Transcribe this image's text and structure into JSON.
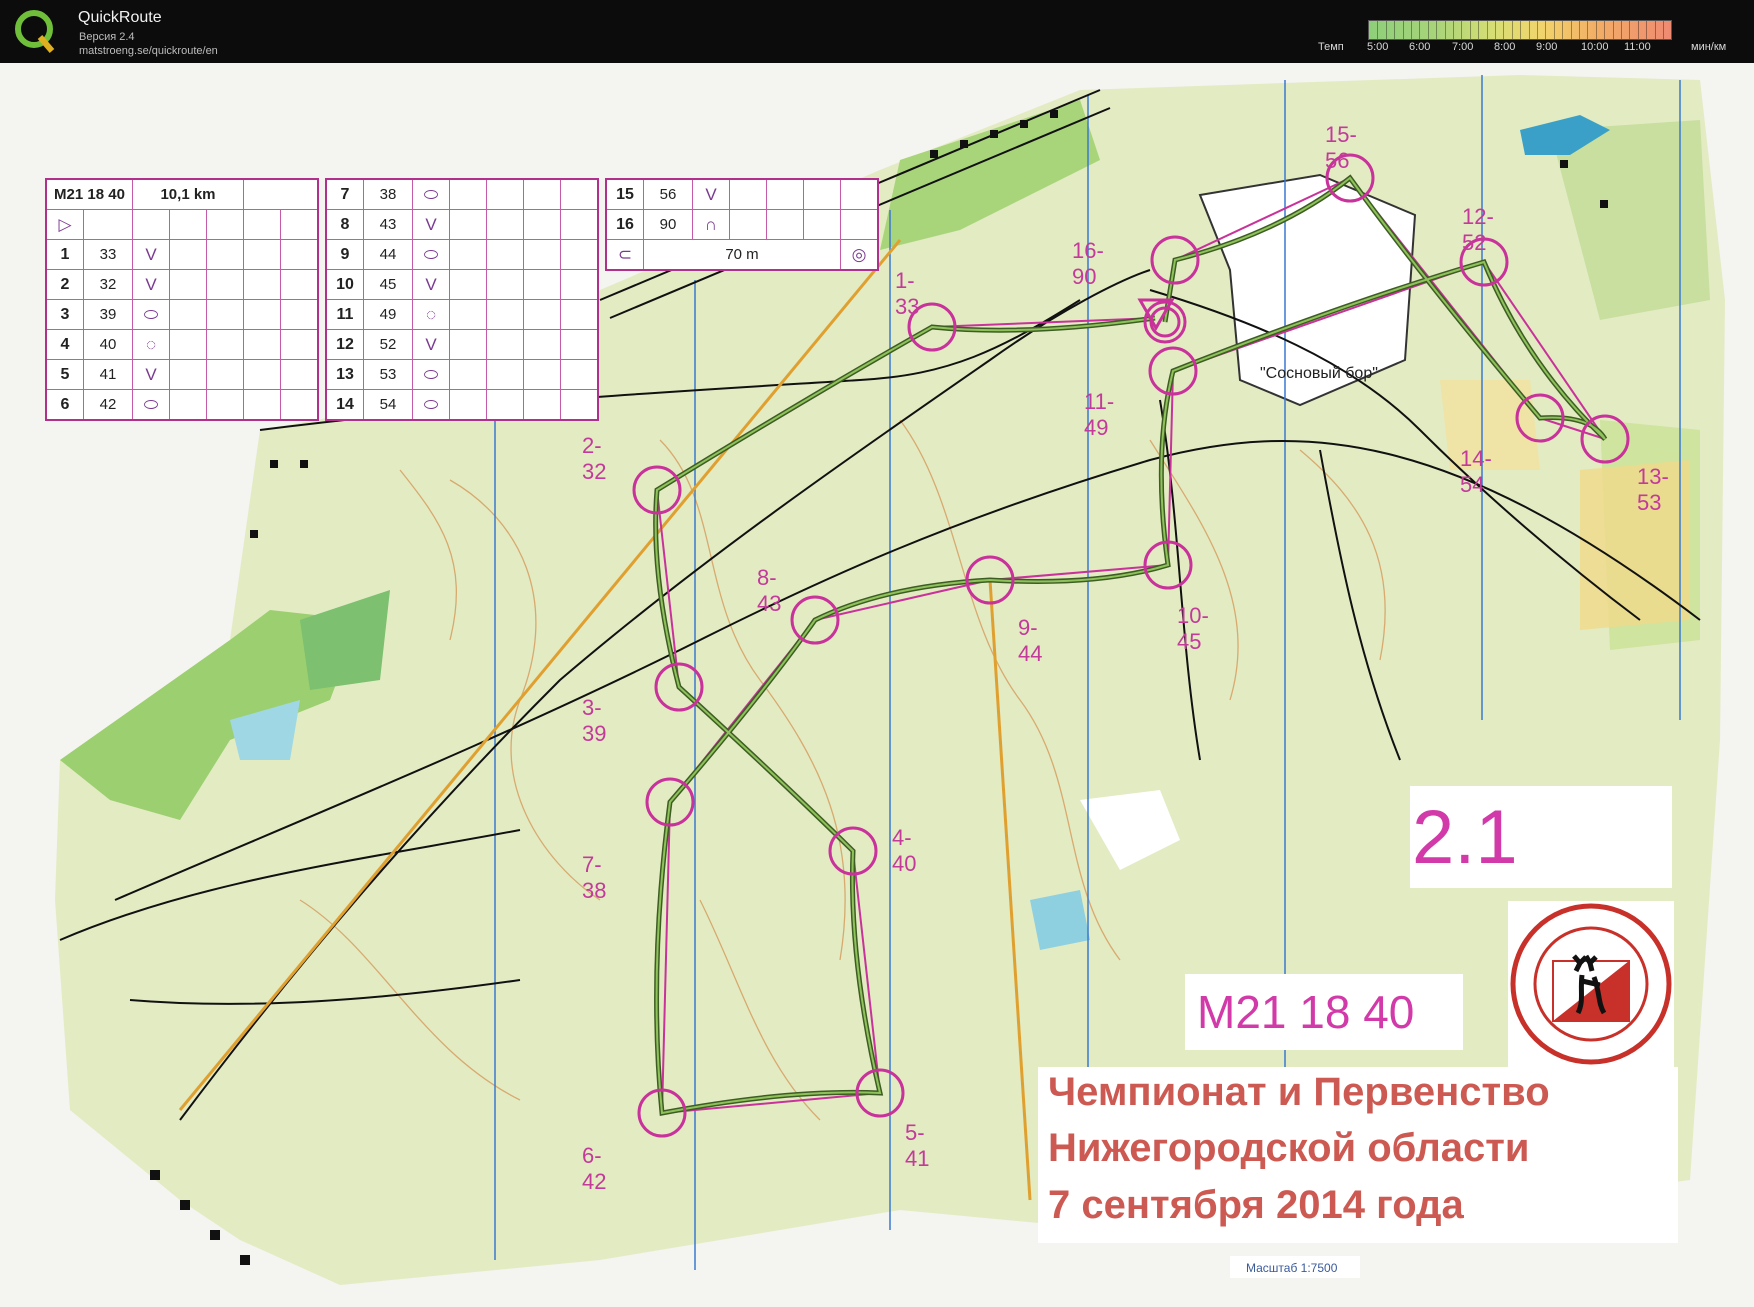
{
  "app": {
    "name": "QuickRoute",
    "version": "Версия 2.4",
    "url": "matstroeng.se/quickroute/en"
  },
  "pace": {
    "label": "Темп",
    "ticks": [
      "5:00",
      "6:00",
      "7:00",
      "8:00",
      "9:00",
      "10:00",
      "11:00"
    ],
    "unit": "мин/км"
  },
  "colors": {
    "course": "#c8329a",
    "route": "#4f7a2e",
    "map_bg": "#e7edc7",
    "contour": "#d49a5a",
    "water": "#3aa0c8",
    "title_bar": "#0c0c0c"
  },
  "course": {
    "class": "M21 18 40",
    "length": "10,1 km",
    "finish_distance": "70 m",
    "controls": [
      {
        "num": "1",
        "code": "33",
        "label": "1-33",
        "cx": 0,
        "cy": 0
      },
      {
        "num": "2",
        "code": "32",
        "label": "2-32"
      },
      {
        "num": "3",
        "code": "39",
        "label": "3-39"
      },
      {
        "num": "4",
        "code": "40",
        "label": "4-40"
      },
      {
        "num": "5",
        "code": "41",
        "label": "5-41"
      },
      {
        "num": "6",
        "code": "42",
        "label": "6-42"
      },
      {
        "num": "7",
        "code": "38",
        "label": "7-38"
      },
      {
        "num": "8",
        "code": "43",
        "label": "8-43"
      },
      {
        "num": "9",
        "code": "44",
        "label": "9-44"
      },
      {
        "num": "10",
        "code": "45",
        "label": "10-45"
      },
      {
        "num": "11",
        "code": "49",
        "label": "11-49"
      },
      {
        "num": "12",
        "code": "52",
        "label": "12-52"
      },
      {
        "num": "13",
        "code": "53",
        "label": "13-53"
      },
      {
        "num": "14",
        "code": "54",
        "label": "14-54"
      },
      {
        "num": "15",
        "code": "56",
        "label": "15-56"
      },
      {
        "num": "16",
        "code": "90",
        "label": "16-90"
      }
    ]
  },
  "map": {
    "day": "2.1",
    "place_name": "\"Сосновый бор\"",
    "event_title": [
      "Чемпионат и Первенство",
      "Нижегородской области",
      "7 сентября 2014 года"
    ],
    "scale": "Масштаб 1:7500",
    "logo_icon": "federation-deer-logo"
  }
}
